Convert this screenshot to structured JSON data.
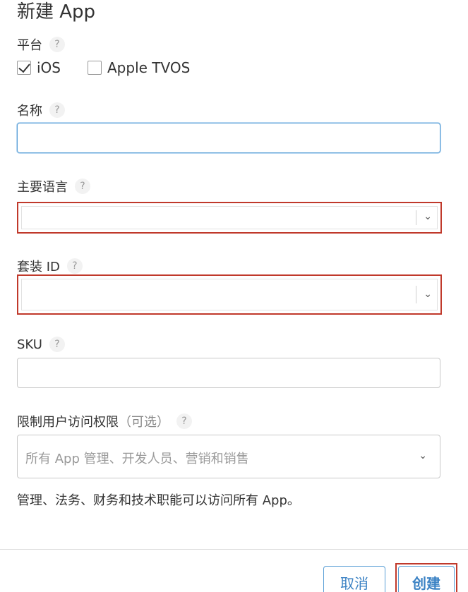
{
  "title": "新建 App",
  "platform": {
    "label": "平台",
    "help": "?",
    "options": [
      {
        "label": "iOS",
        "checked": true
      },
      {
        "label": "Apple TVOS",
        "checked": false
      }
    ]
  },
  "name": {
    "label": "名称",
    "help": "?",
    "value": ""
  },
  "primary_language": {
    "label": "主要语言",
    "help": "?",
    "value": "",
    "icon": "chevron-down-icon"
  },
  "bundle_id": {
    "label": "套装 ID",
    "help": "?",
    "value": "",
    "icon": "chevron-down-icon"
  },
  "sku": {
    "label": "SKU",
    "help": "?",
    "value": ""
  },
  "access": {
    "label": "限制用户访问权限",
    "optional": "（可选）",
    "help": "?",
    "placeholder": "所有 App 管理、开发人员、营销和销售",
    "icon": "chevron-down-icon",
    "note": "管理、法务、财务和技术职能可以访问所有 App。"
  },
  "footer": {
    "cancel_label": "取消",
    "create_label": "创建"
  },
  "colors": {
    "highlight": "#c0392b",
    "focus": "#5a9fd6",
    "link": "#3b82c4"
  }
}
